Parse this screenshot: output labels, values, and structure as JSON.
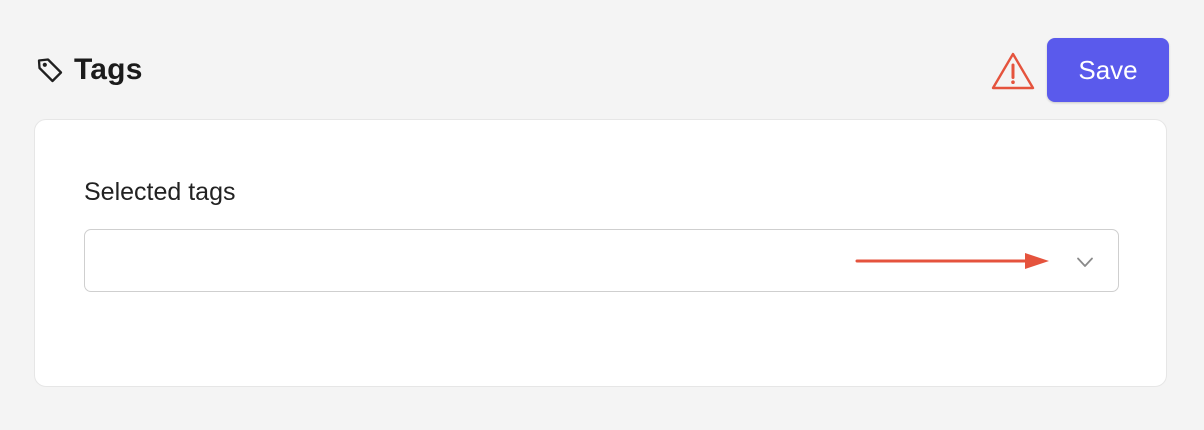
{
  "header": {
    "title": "Tags",
    "icon": "tag-icon",
    "warning_icon": "warning-icon",
    "warning_color": "#e5533d",
    "save_label": "Save",
    "save_color": "#5a5aec"
  },
  "card": {
    "field_label": "Selected tags",
    "select_value": "",
    "dropdown_icon": "chevron-down-icon",
    "annotation_icon": "right-arrow-icon",
    "annotation_color": "#e5533d"
  }
}
